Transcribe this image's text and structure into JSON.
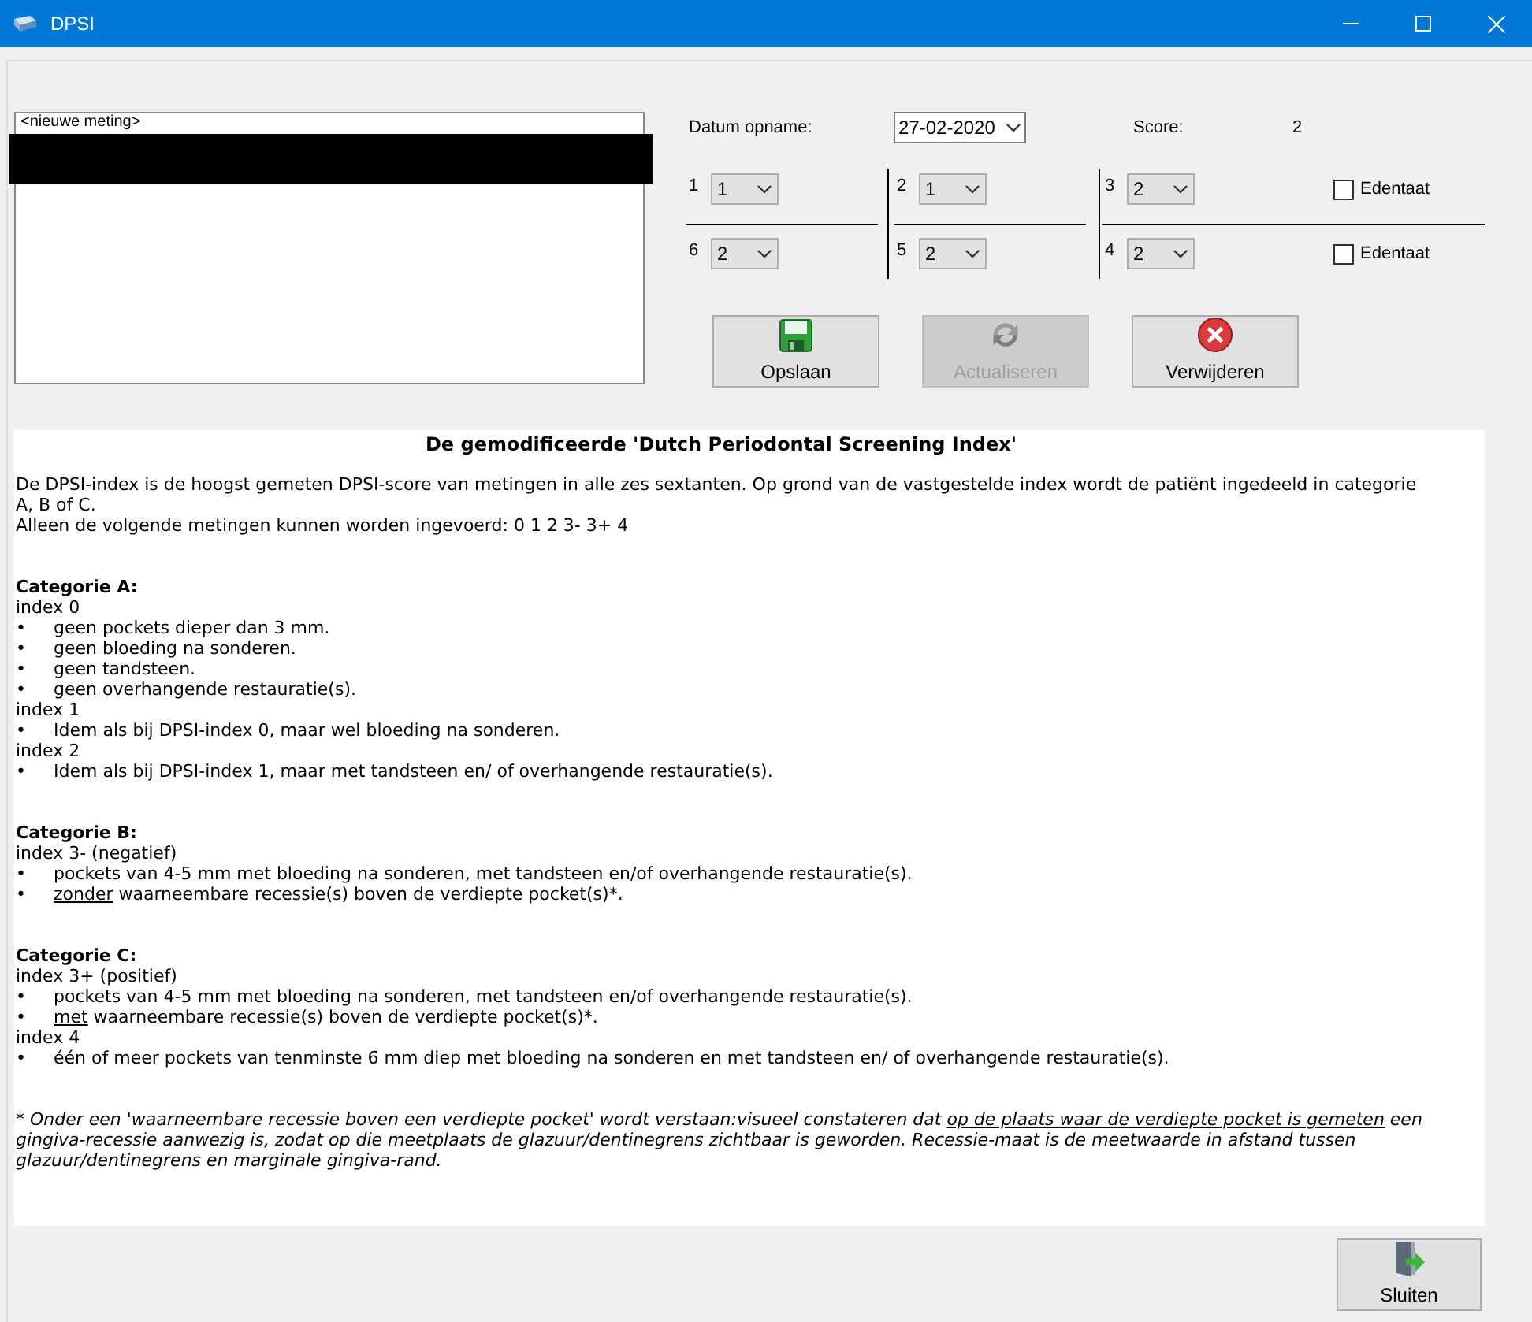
{
  "window": {
    "title": "DPSI"
  },
  "measurements": {
    "items": [
      {
        "text": "<nieuwe meting>"
      }
    ]
  },
  "date": {
    "label": "Datum opname:",
    "value": "27-02-2020"
  },
  "score": {
    "label": "Score:",
    "value": "2"
  },
  "sextants": [
    {
      "label": "1",
      "value": "1"
    },
    {
      "label": "2",
      "value": "1"
    },
    {
      "label": "3",
      "value": "2"
    },
    {
      "label": "6",
      "value": "2"
    },
    {
      "label": "5",
      "value": "2"
    },
    {
      "label": "4",
      "value": "2"
    }
  ],
  "edentulous": [
    {
      "label": "Edentaat",
      "checked": false
    },
    {
      "label": "Edentaat",
      "checked": false
    }
  ],
  "buttons": [
    {
      "label": "Opslaan",
      "kind": "save",
      "disabled": false
    },
    {
      "label": "Actualiseren",
      "kind": "refresh",
      "disabled": true
    },
    {
      "label": "Verwijderen",
      "kind": "delete",
      "disabled": false
    }
  ],
  "info": {
    "title": "De gemodificeerde 'Dutch Periodontal Screening Index'",
    "blocks": [
      {
        "kind": "text",
        "text": "De DPSI-index is de hoogst gemeten DPSI-score van metingen in alle zes sextanten. Op grond van de vastgestelde index wordt de patiënt ingedeeld in categorie A, B of C."
      },
      {
        "kind": "text",
        "text": "Alleen de volgende metingen kunnen worden ingevoerd: 0  1  2  3-  3+  4"
      },
      {
        "kind": "heading",
        "text": "Categorie A:"
      },
      {
        "kind": "text",
        "text": "index 0"
      },
      {
        "kind": "bullet",
        "marker": "•",
        "text": "geen pockets dieper dan 3 mm."
      },
      {
        "kind": "bullet",
        "marker": "•",
        "text": "geen bloeding na sonderen."
      },
      {
        "kind": "bullet",
        "marker": "•",
        "text": "geen tandsteen."
      },
      {
        "kind": "bullet",
        "marker": "•",
        "text": "geen overhangende restauratie(s)."
      },
      {
        "kind": "text",
        "text": "index 1"
      },
      {
        "kind": "bullet",
        "marker": "•",
        "text": "Idem als bij DPSI-index 0, maar wel bloeding na sonderen."
      },
      {
        "kind": "text",
        "text": "index 2"
      },
      {
        "kind": "bullet",
        "marker": "•",
        "text": "Idem als bij DPSI-index 1, maar met tandsteen en/ of overhangende restauratie(s)."
      },
      {
        "kind": "heading",
        "text": "Categorie B:"
      },
      {
        "kind": "text",
        "text": "index 3- (negatief)"
      },
      {
        "kind": "bullet",
        "marker": "•",
        "text": "pockets van 4-5 mm met bloeding na sonderen, met tandsteen en/of overhangende restauratie(s)."
      },
      {
        "kind": "bullet",
        "marker": "•",
        "parts": [
          {
            "text": "zonder",
            "underline": true
          },
          {
            "text": " waarneembare recessie(s) boven de verdiepte pocket(s)*.",
            "underline": false
          }
        ]
      },
      {
        "kind": "heading",
        "text": "Categorie C:"
      },
      {
        "kind": "text",
        "text": "index 3+ (positief)"
      },
      {
        "kind": "bullet",
        "marker": "•",
        "text": "pockets van 4-5 mm met bloeding na sonderen, met tandsteen en/of overhangende restauratie(s)."
      },
      {
        "kind": "bullet",
        "marker": "•",
        "parts": [
          {
            "text": "met",
            "underline": true
          },
          {
            "text": " waarneembare recessie(s) boven de verdiepte pocket(s)*.",
            "underline": false
          }
        ]
      },
      {
        "kind": "text",
        "text": "index 4"
      },
      {
        "kind": "bullet",
        "marker": "•",
        "text": "één of meer pockets van tenminste 6 mm diep met bloeding na sonderen en met tandsteen en/ of overhangende restauratie(s)."
      },
      {
        "kind": "footnote",
        "parts": [
          {
            "text": "* Onder een 'waarneembare recessie boven een verdiepte pocket'  wordt verstaan:visueel constateren dat ",
            "underline": false
          },
          {
            "text": "op de plaats waar de  verdiepte pocket is gemeten",
            "underline": true
          },
          {
            "text": " een gingiva-recessie aanwezig is, zodat op die meetplaats de glazuur/dentinegrens zichtbaar is geworden. Recessie-maat is de meetwaarde in afstand tussen glazuur/dentinegrens en marginale gingiva-rand.",
            "underline": false
          }
        ]
      }
    ]
  },
  "close_button": {
    "label": "Sluiten"
  }
}
